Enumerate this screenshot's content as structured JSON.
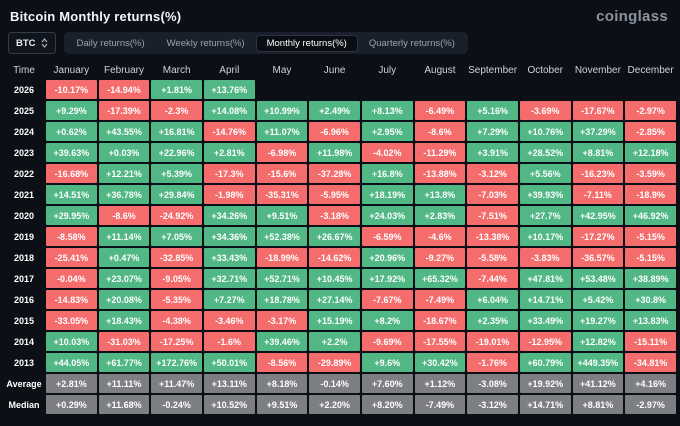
{
  "header": {
    "title": "Bitcoin Monthly returns(%)",
    "logo": "coinglass"
  },
  "controls": {
    "coin_selector": {
      "label": "BTC",
      "icon": "updown-chevron-icon"
    },
    "tabs": [
      {
        "label": "Daily returns(%)",
        "active": false
      },
      {
        "label": "Weekly returns(%)",
        "active": false
      },
      {
        "label": "Monthly returns(%)",
        "active": true
      },
      {
        "label": "Quarterly returns(%)",
        "active": false
      }
    ]
  },
  "colors": {
    "positive": "#50b785",
    "negative": "#f56c6c",
    "summary": "#7d7f82",
    "background": "#0c0f15"
  },
  "table": {
    "columns": [
      "Time",
      "January",
      "February",
      "March",
      "April",
      "May",
      "June",
      "July",
      "August",
      "September",
      "October",
      "November",
      "December"
    ],
    "rows": [
      {
        "time": "2026",
        "values": [
          "-10.17%",
          "-14.94%",
          "+1.81%",
          "+13.76%",
          "",
          "",
          "",
          "",
          "",
          "",
          "",
          ""
        ]
      },
      {
        "time": "2025",
        "values": [
          "+9.29%",
          "-17.39%",
          "-2.3%",
          "+14.08%",
          "+10.99%",
          "+2.49%",
          "+8.13%",
          "-6.49%",
          "+5.16%",
          "-3.69%",
          "-17.67%",
          "-2.97%"
        ]
      },
      {
        "time": "2024",
        "values": [
          "+0.62%",
          "+43.55%",
          "+16.81%",
          "-14.76%",
          "+11.07%",
          "-6.96%",
          "+2.95%",
          "-8.6%",
          "+7.29%",
          "+10.76%",
          "+37.29%",
          "-2.85%"
        ]
      },
      {
        "time": "2023",
        "values": [
          "+39.63%",
          "+0.03%",
          "+22.96%",
          "+2.81%",
          "-6.98%",
          "+11.98%",
          "-4.02%",
          "-11.29%",
          "+3.91%",
          "+28.52%",
          "+8.81%",
          "+12.18%"
        ]
      },
      {
        "time": "2022",
        "values": [
          "-16.68%",
          "+12.21%",
          "+5.39%",
          "-17.3%",
          "-15.6%",
          "-37.28%",
          "+16.8%",
          "-13.88%",
          "-3.12%",
          "+5.56%",
          "-16.23%",
          "-3.59%"
        ]
      },
      {
        "time": "2021",
        "values": [
          "+14.51%",
          "+36.78%",
          "+29.84%",
          "-1.98%",
          "-35.31%",
          "-5.95%",
          "+18.19%",
          "+13.8%",
          "-7.03%",
          "+39.93%",
          "-7.11%",
          "-18.9%"
        ]
      },
      {
        "time": "2020",
        "values": [
          "+29.95%",
          "-8.6%",
          "-24.92%",
          "+34.26%",
          "+9.51%",
          "-3.18%",
          "+24.03%",
          "+2.83%",
          "-7.51%",
          "+27.7%",
          "+42.95%",
          "+46.92%"
        ]
      },
      {
        "time": "2019",
        "values": [
          "-8.58%",
          "+11.14%",
          "+7.05%",
          "+34.36%",
          "+52.38%",
          "+26.67%",
          "-6.59%",
          "-4.6%",
          "-13.38%",
          "+10.17%",
          "-17.27%",
          "-5.15%"
        ]
      },
      {
        "time": "2018",
        "values": [
          "-25.41%",
          "+0.47%",
          "-32.85%",
          "+33.43%",
          "-18.99%",
          "-14.62%",
          "+20.96%",
          "-9.27%",
          "-5.58%",
          "-3.83%",
          "-36.57%",
          "-5.15%"
        ]
      },
      {
        "time": "2017",
        "values": [
          "-0.04%",
          "+23.07%",
          "-9.05%",
          "+32.71%",
          "+52.71%",
          "+10.45%",
          "+17.92%",
          "+65.32%",
          "-7.44%",
          "+47.81%",
          "+53.48%",
          "+38.89%"
        ]
      },
      {
        "time": "2016",
        "values": [
          "-14.83%",
          "+20.08%",
          "-5.35%",
          "+7.27%",
          "+18.78%",
          "+27.14%",
          "-7.67%",
          "-7.49%",
          "+6.04%",
          "+14.71%",
          "+5.42%",
          "+30.8%"
        ]
      },
      {
        "time": "2015",
        "values": [
          "-33.05%",
          "+18.43%",
          "-4.38%",
          "-3.46%",
          "-3.17%",
          "+15.19%",
          "+8.2%",
          "-18.67%",
          "+2.35%",
          "+33.49%",
          "+19.27%",
          "+13.83%"
        ]
      },
      {
        "time": "2014",
        "values": [
          "+10.03%",
          "-31.03%",
          "-17.25%",
          "-1.6%",
          "+39.46%",
          "+2.2%",
          "-9.69%",
          "-17.55%",
          "-19.01%",
          "-12.95%",
          "+12.82%",
          "-15.11%"
        ]
      },
      {
        "time": "2013",
        "values": [
          "+44.05%",
          "+61.77%",
          "+172.76%",
          "+50.01%",
          "-8.56%",
          "-29.89%",
          "+9.6%",
          "+30.42%",
          "-1.76%",
          "+60.79%",
          "+449.35%",
          "-34.81%"
        ]
      }
    ],
    "summary_rows": [
      {
        "time": "Average",
        "values": [
          "+2.81%",
          "+11.11%",
          "+11.47%",
          "+13.11%",
          "+8.18%",
          "-0.14%",
          "+7.60%",
          "+1.12%",
          "-3.08%",
          "+19.92%",
          "+41.12%",
          "+4.16%"
        ]
      },
      {
        "time": "Median",
        "values": [
          "+0.29%",
          "+11.68%",
          "-0.24%",
          "+10.52%",
          "+9.51%",
          "+2.20%",
          "+8.20%",
          "-7.49%",
          "-3.12%",
          "+14.71%",
          "+8.81%",
          "-2.97%"
        ]
      }
    ]
  }
}
